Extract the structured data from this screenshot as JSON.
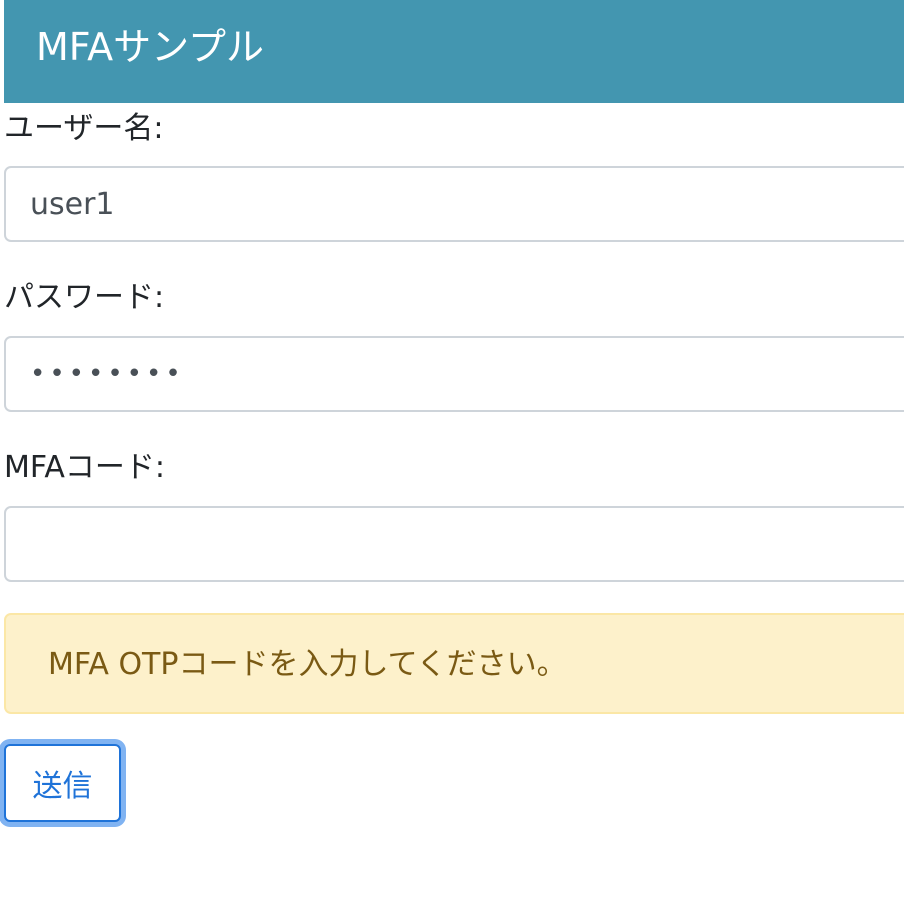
{
  "header": {
    "title": "MFAサンプル",
    "background_color": "#4396b0"
  },
  "form": {
    "username": {
      "label": "ユーザー名:",
      "value": "user1"
    },
    "password": {
      "label": "パスワード:",
      "value": "••••••••"
    },
    "mfa_code": {
      "label": "MFAコード:",
      "value": ""
    },
    "alert": {
      "message": "MFA OTPコードを入力してください。",
      "background_color": "#fdf1cb",
      "text_color": "#7a5a14"
    },
    "submit_label": "送信",
    "accent_color": "#1f73d8"
  }
}
